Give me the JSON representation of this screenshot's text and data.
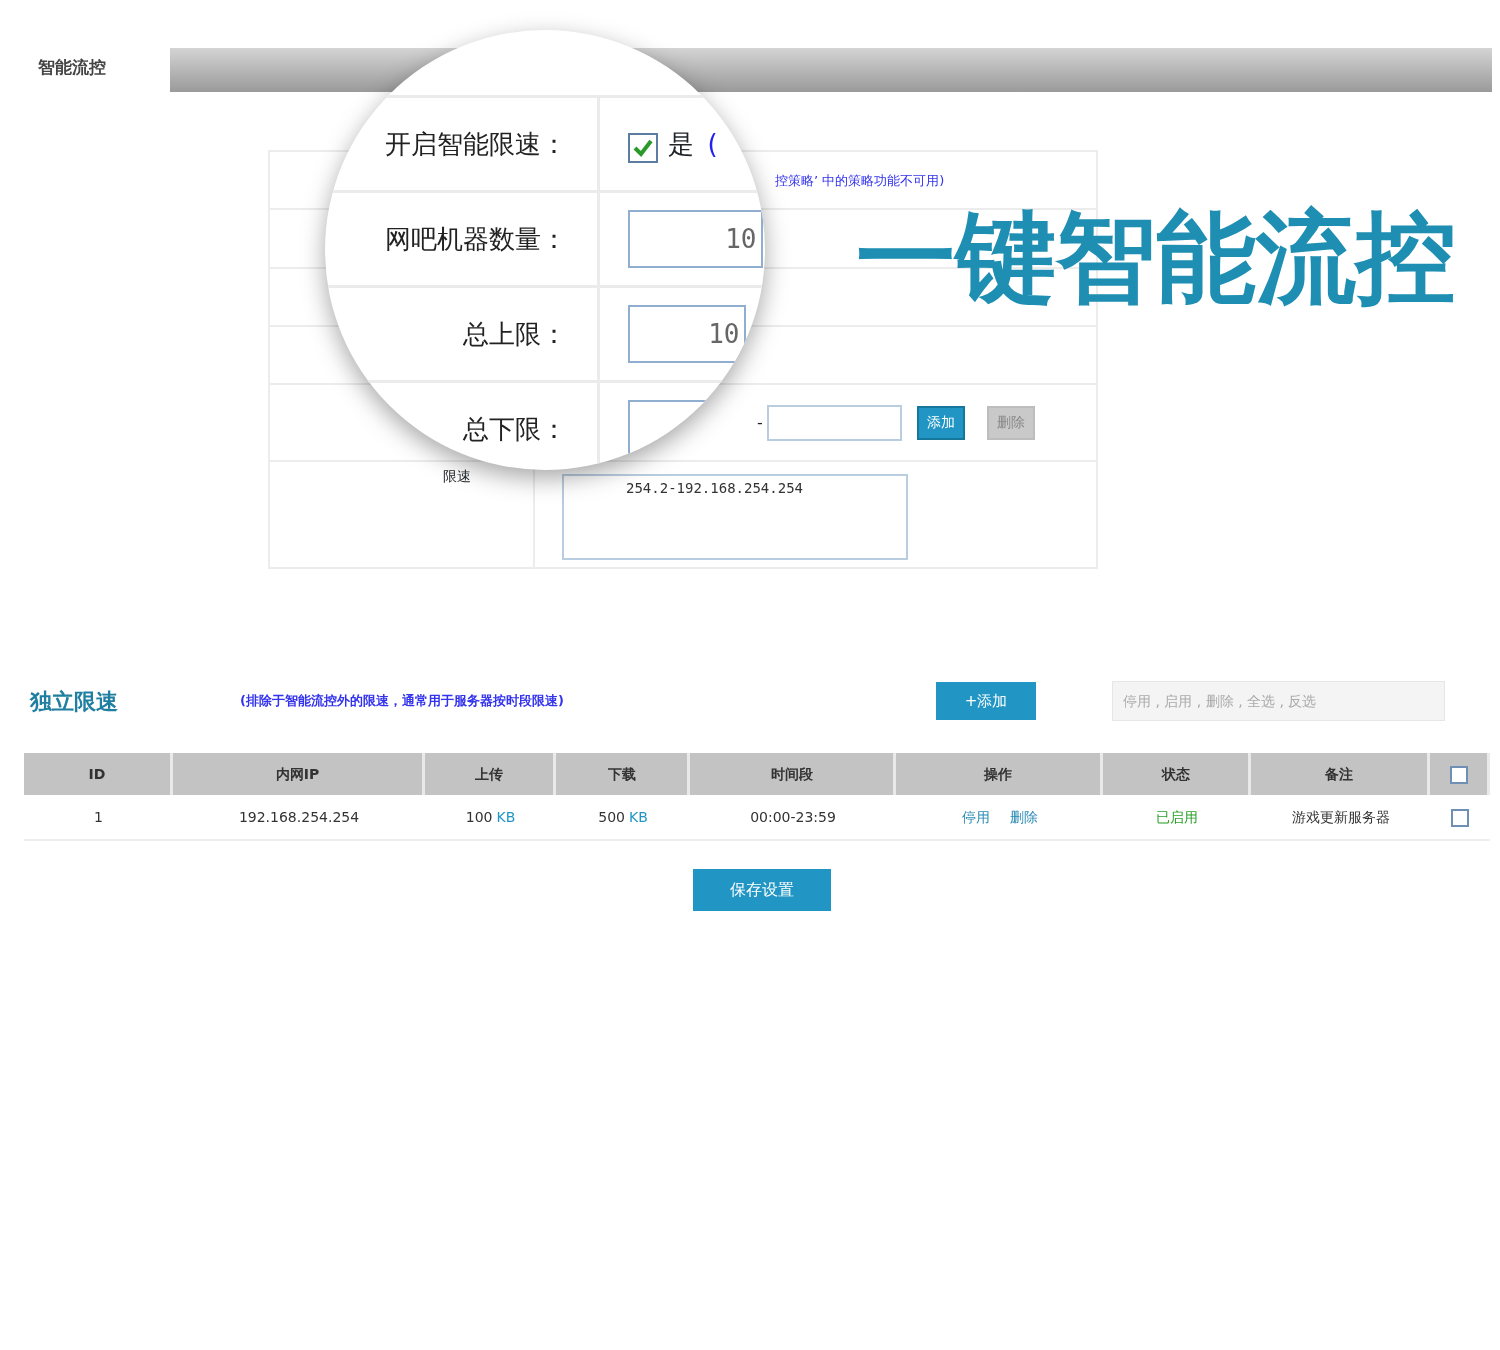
{
  "tab": {
    "label": "智能流控",
    "selected": true
  },
  "headline": "一键智能流控",
  "lens": {
    "rows": [
      {
        "kind": "checkbox",
        "label": "开启智能限速：",
        "checked": true,
        "option": "是",
        "note": "("
      },
      {
        "kind": "input",
        "label": "网吧机器数量：",
        "value": "10"
      },
      {
        "kind": "input",
        "label": "总上限：",
        "value": "10"
      },
      {
        "kind": "input",
        "label": "总下限："
      }
    ]
  },
  "form": {
    "hint": "控策略’ 中的策略功能不可用)",
    "separator": "-",
    "range_buttons": [
      {
        "label": "添加",
        "disabled": false
      },
      {
        "label": "删除",
        "disabled": true
      }
    ],
    "list_label": "限速",
    "list_value": "254.2-192.168.254.254"
  },
  "independent": {
    "title": "独立限速",
    "hint": "(排除于智能流控外的限速，通常用于服务器按时段限速)",
    "add_button": "+添加",
    "batch_actions": "停用 , 启用 , 删除 , 全选 , 反选",
    "columns": [
      "ID",
      "内网IP",
      "上传",
      "下载",
      "时间段",
      "操作",
      "状态",
      "备注"
    ],
    "header_checkbox": {
      "checked": false
    },
    "rows": [
      {
        "id": "1",
        "ip": "192.168.254.254",
        "upload": "100",
        "upload_unit": "KB",
        "download": "500",
        "download_unit": "KB",
        "time": "00:00-23:59",
        "actions": [
          "停用",
          "删除"
        ],
        "status": "已启用",
        "remark": "游戏更新服务器",
        "checked": false
      }
    ]
  },
  "save_button": "保存设置"
}
